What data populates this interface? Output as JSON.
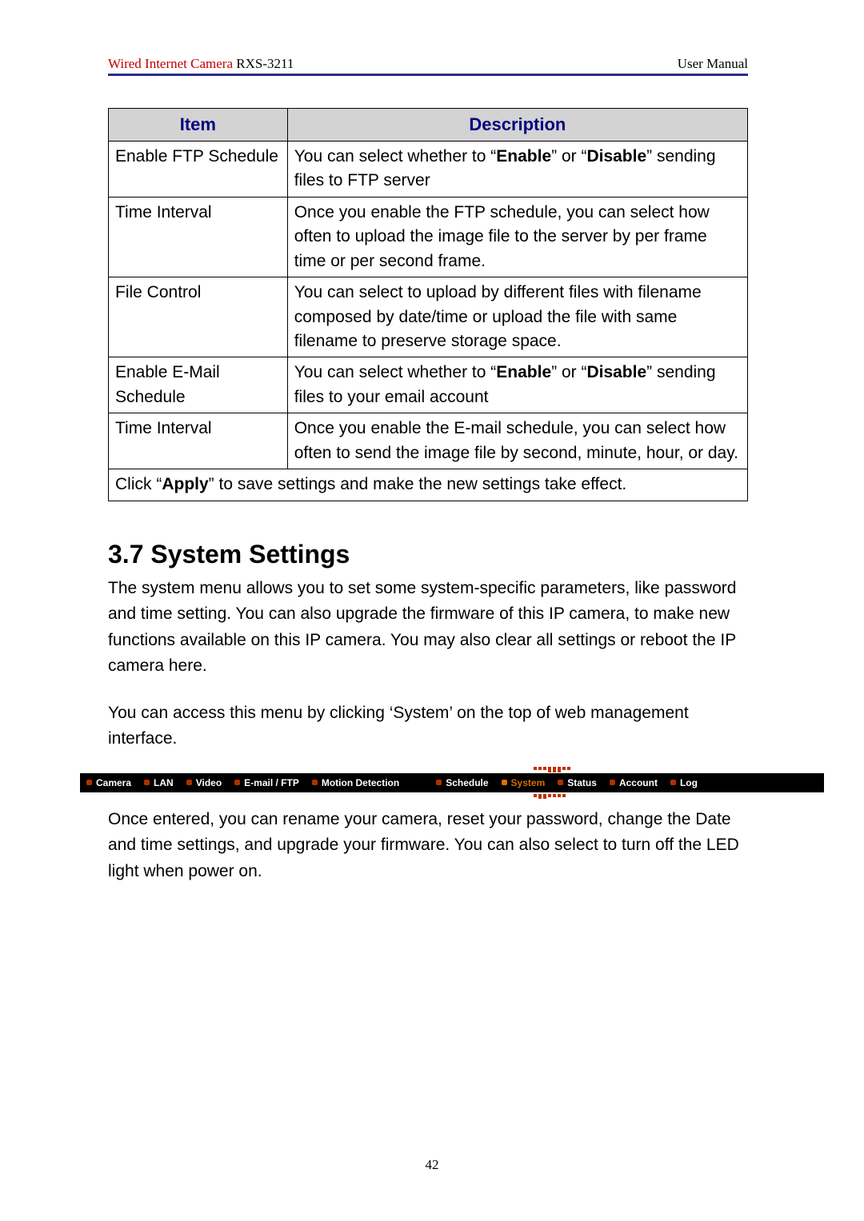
{
  "header": {
    "product": "Wired Internet Camera",
    "model": "RXS-3211",
    "right": "User Manual"
  },
  "table": {
    "head_item": "Item",
    "head_desc": "Description",
    "rows": [
      {
        "item": "Enable FTP Schedule",
        "desc_pre": "You can select whether to “",
        "desc_b1": "Enable",
        "desc_mid": "” or “",
        "desc_b2": "Disable",
        "desc_post": "” sending files to FTP server"
      },
      {
        "item": "Time Interval",
        "desc": "Once you enable the FTP schedule, you can select how often to upload the image file to the server by per frame time or per second frame."
      },
      {
        "item": "File Control",
        "desc": "You can select to upload by different files with filename composed by date/time or upload the file with same filename to preserve storage space."
      },
      {
        "item": "Enable E-Mail Schedule",
        "desc_pre": "You can select whether to “",
        "desc_b1": "Enable",
        "desc_mid": "” or “",
        "desc_b2": "Disable",
        "desc_post": "” sending files to your email account"
      },
      {
        "item": "Time Interval",
        "desc": "Once you enable the E-mail schedule, you can select how often to send the image file by second, minute, hour, or day."
      }
    ],
    "footer_pre": "Click “",
    "footer_b": "Apply",
    "footer_post": "” to save settings and make the new settings take effect."
  },
  "section": {
    "title": "3.7 System Settings",
    "para1": "The system menu allows you to set some system-specific parameters, like password and time setting. You can also upgrade the firmware of this IP camera, to make new functions available on this IP camera. You may also clear all settings or reboot the IP camera here.",
    "para2": "You can access this menu by clicking ‘System’ on the top of web management interface.",
    "para3": "Once entered, you can rename your camera, reset your password, change the Date and time settings, and upgrade your firmware. You can also select to turn off the LED light when power on."
  },
  "nav": {
    "items": [
      "Camera",
      "LAN",
      "Video",
      "E-mail / FTP",
      "Motion Detection",
      "Schedule",
      "System",
      "Status",
      "Account",
      "Log"
    ],
    "selected_index": 6
  },
  "page_number": "42"
}
